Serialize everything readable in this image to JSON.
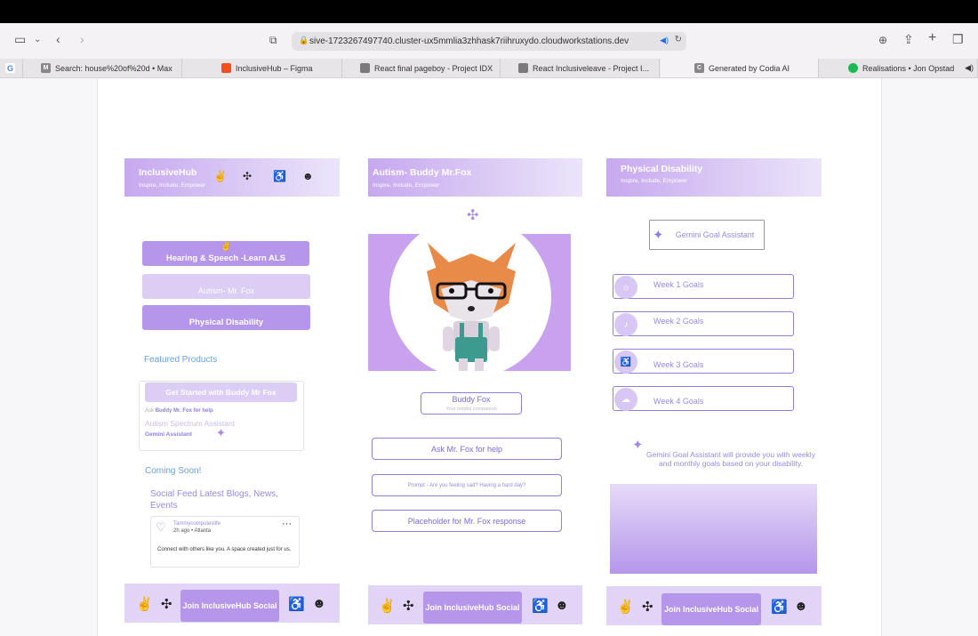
{
  "browser": {
    "url": "sive-1723267497740.cluster-ux5mmlia3zhhask7riihruxydo.cloudworkstations.dev",
    "tabs": [
      {
        "label": "Search: house%20of%20d • Max"
      },
      {
        "label": "InclusiveHub – Figma"
      },
      {
        "label": "React final pageboy - Project IDX"
      },
      {
        "label": "React Inclusiveleave - Project I..."
      },
      {
        "label": "Generated by Codia AI"
      },
      {
        "label": "Realisations • Jon Opstad"
      }
    ]
  },
  "col1": {
    "title": "InclusiveHub",
    "subtitle": "Inspire, Include, Empower",
    "btn_hearing": "Hearing & Speech -Learn ALS",
    "btn_autism": "Autism- Mr. Fox",
    "btn_physical": "Physical Disability",
    "featured": "Featured Products",
    "get_started": "Get Started with Buddy Mr Fox",
    "ask_line": "Ask",
    "ask_bold": "Buddy Mr. Fox for help",
    "autism_assistant": "Autism Spectrum Assistant",
    "gemini_assistant": "Gemini Assistant",
    "coming_soon": "Coming Soon!",
    "social_feed": "Social Feed Latest Blogs, News, Events",
    "post_user": "Tammycomputeslife",
    "post_meta": "2h ago • Atlanta",
    "post_text": "Connect with others like you. A space created just for us."
  },
  "col2": {
    "title": "Autism- Buddy Mr.Fox",
    "subtitle": "Inspire, Include, Empower",
    "buddy_name": "Buddy Fox",
    "buddy_sub": "Your helpful companion",
    "ask_button": "Ask Mr. Fox for help",
    "prompt_placeholder": "Prompt - Are you feeling sad? Having a hard day?",
    "response_placeholder": "Placeholder for Mr. Fox response"
  },
  "col3": {
    "title": "Physical Disability",
    "subtitle": "Inspire, Include, Empower",
    "gemini_button": "Gemini Goal Assistant",
    "weeks": [
      "Week 1 Goals",
      "Week 2 Goals",
      "Week 3 Goals",
      "Week 4 Goals"
    ],
    "gemini_desc": "Gemini Goal Assistant will provide you with weekly and monthly goals based on your disability."
  },
  "footer": {
    "join_label": "Join InclusiveHub Social"
  },
  "colors": {
    "accent": "#b596eb",
    "light_accent": "#dccdf5",
    "outline": "#8e7fe0",
    "link": "#6c9fd6"
  },
  "icons": [
    "sign-language-icon",
    "puzzle-icon",
    "wheelchair-icon",
    "robot-icon",
    "sparkle-icon"
  ]
}
